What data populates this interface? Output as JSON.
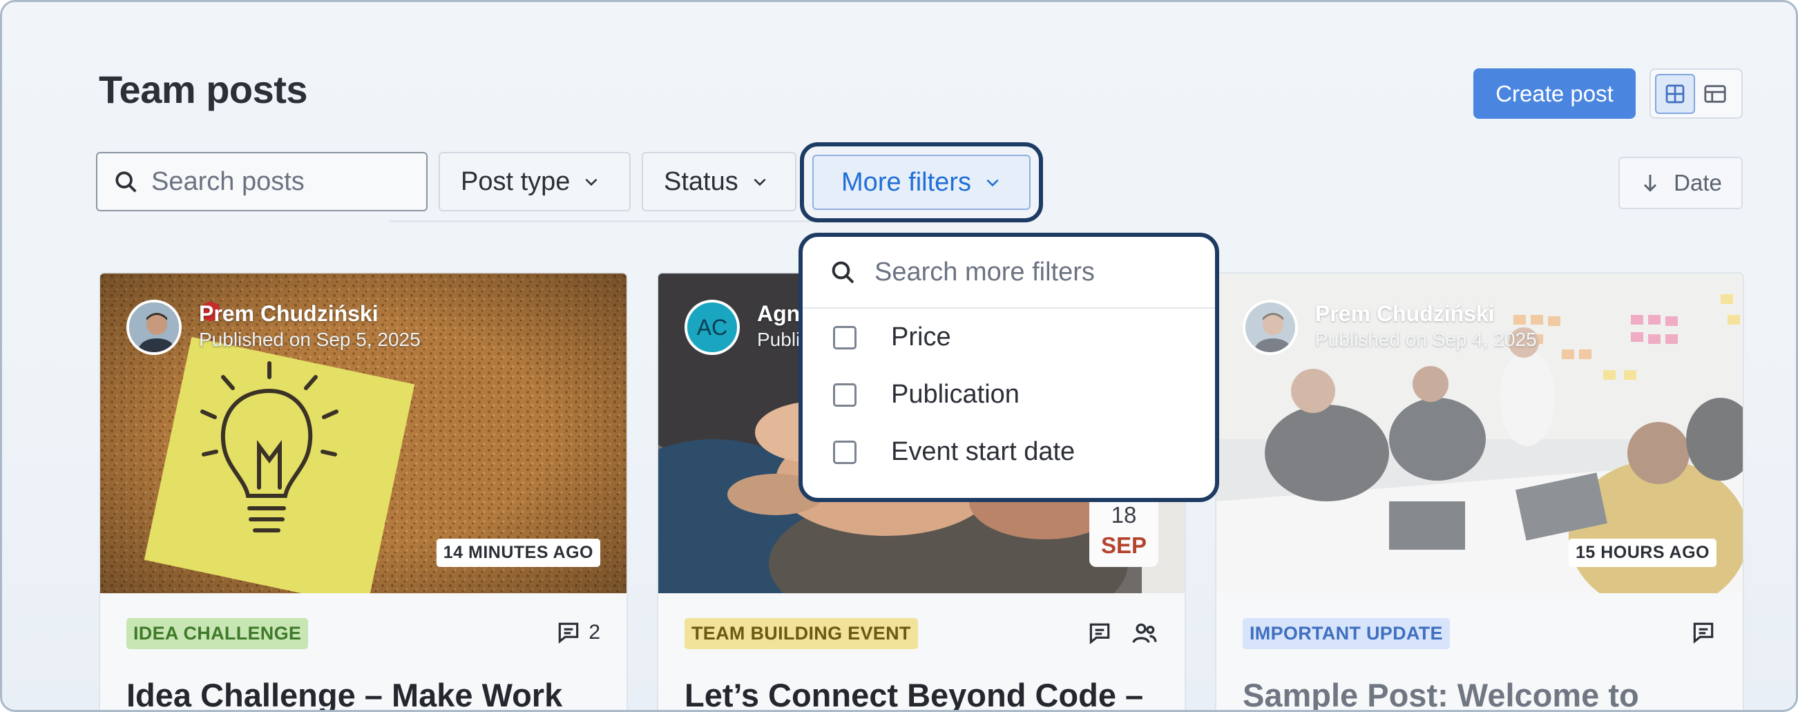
{
  "header": {
    "title": "Team posts",
    "create_label": "Create post",
    "views": [
      "grid-view-icon",
      "table-view-icon"
    ]
  },
  "filters": {
    "search_placeholder": "Search posts",
    "post_type_label": "Post type",
    "status_label": "Status",
    "more_filters_label": "More filters",
    "sort_label": "Date"
  },
  "dropdown": {
    "search_placeholder": "Search more filters",
    "options": [
      {
        "label": "Price",
        "checked": false
      },
      {
        "label": "Publication",
        "checked": false
      },
      {
        "label": "Event start date",
        "checked": false
      }
    ]
  },
  "cards": [
    {
      "author": "Prem Chudziński",
      "published": "Published on Sep 5, 2025",
      "badge": "14 MINUTES AGO",
      "tag": "IDEA CHALLENGE",
      "comments": "2",
      "title": "Idea Challenge – Make Work"
    },
    {
      "author": "Agn",
      "initials": "AC",
      "published": "Publi",
      "date_day": "18",
      "date_month": "SEP",
      "tag": "TEAM BUILDING EVENT",
      "title": "Let’s Connect Beyond Code –"
    },
    {
      "author": "Prem Chudziński",
      "published": "Published on Sep 4, 2025",
      "badge": "15 HOURS AGO",
      "tag": "IMPORTANT UPDATE",
      "title": "Sample Post: Welcome to"
    }
  ],
  "colors": {
    "accent": "#4a86e0",
    "focus_ring": "#1d3b63",
    "tag_idea_bg": "#c8e6b4",
    "tag_idea_fg": "#3f7a2a",
    "tag_event_bg": "#f2e39a",
    "tag_event_fg": "#6b5a12",
    "tag_update_bg": "#d7e4fb",
    "tag_update_fg": "#3f6fbf"
  }
}
